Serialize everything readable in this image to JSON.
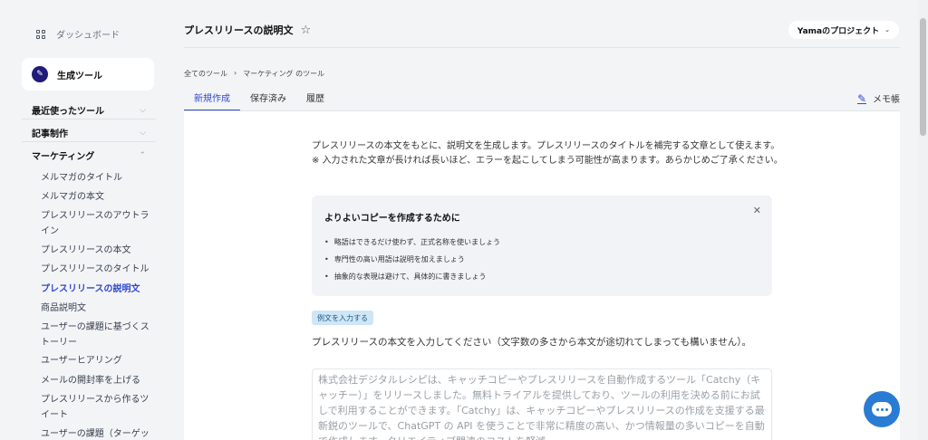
{
  "sidebar": {
    "dashboard": "ダッシュボード",
    "gen_tool": "生成ツール",
    "sections": {
      "recent": "最近使ったツール",
      "articles": "記事制作",
      "marketing": "マーケティング"
    },
    "items": [
      "メルマガのタイトル",
      "メルマガの本文",
      "プレスリリースのアウトライン",
      "プレスリリースの本文",
      "プレスリリースのタイトル",
      "プレスリリースの説明文",
      "商品説明文",
      "ユーザーの課題に基づくストーリー",
      "ユーザーヒアリング",
      "メールの開封率を上げる",
      "プレスリリースから作るツイート",
      "ユーザーの課題（ターゲット"
    ]
  },
  "header": {
    "title": "プレスリリースの説明文",
    "project": "Yamaのプロジェクト"
  },
  "breadcrumb": [
    "全てのツール",
    "マーケティング のツール"
  ],
  "tabs": [
    "新規作成",
    "保存済み",
    "履歴"
  ],
  "memo": "メモ帳",
  "main": {
    "description": "プレスリリースの本文をもとに、説明文を生成します。プレスリリースのタイトルを補完する文章として使えます。※ 入力された文章が長ければ長いほど、エラーを起こしてしまう可能性が高まります。あらかじめご了承ください。",
    "tips_title": "よりよいコピーを作成するために",
    "tips": [
      "略語はできるだけ使わず、正式名称を使いましょう",
      "専門性の高い用語は説明を加えましょう",
      "抽象的な表現は避けて、具体的に書きましょう"
    ],
    "example_button": "例文を入力する",
    "prompt": "プレスリリースの本文を入力してください（文字数の多さから本文が途切れてしまっても構いません）。",
    "textarea_placeholder": "株式会社デジタルレシピは、キャッチコピーやプレスリリースを自動作成するツール「Catchy（キャッチー）」をリリースしました。無料トライアルを提供しており、ツールの利用を決める前にお試しで利用することができます。「Catchy」は、キャッチコピーやプレスリリースの作成を支援する最新鋭のツールで、ChatGPT の API を使うことで非常に精度の高い、かつ情報量の多いコピーを自動で作成します。クリエイティブ関連のコストを軽減"
  },
  "colors": {
    "accent": "#2f4ad1",
    "chat": "#2a7bd3"
  }
}
